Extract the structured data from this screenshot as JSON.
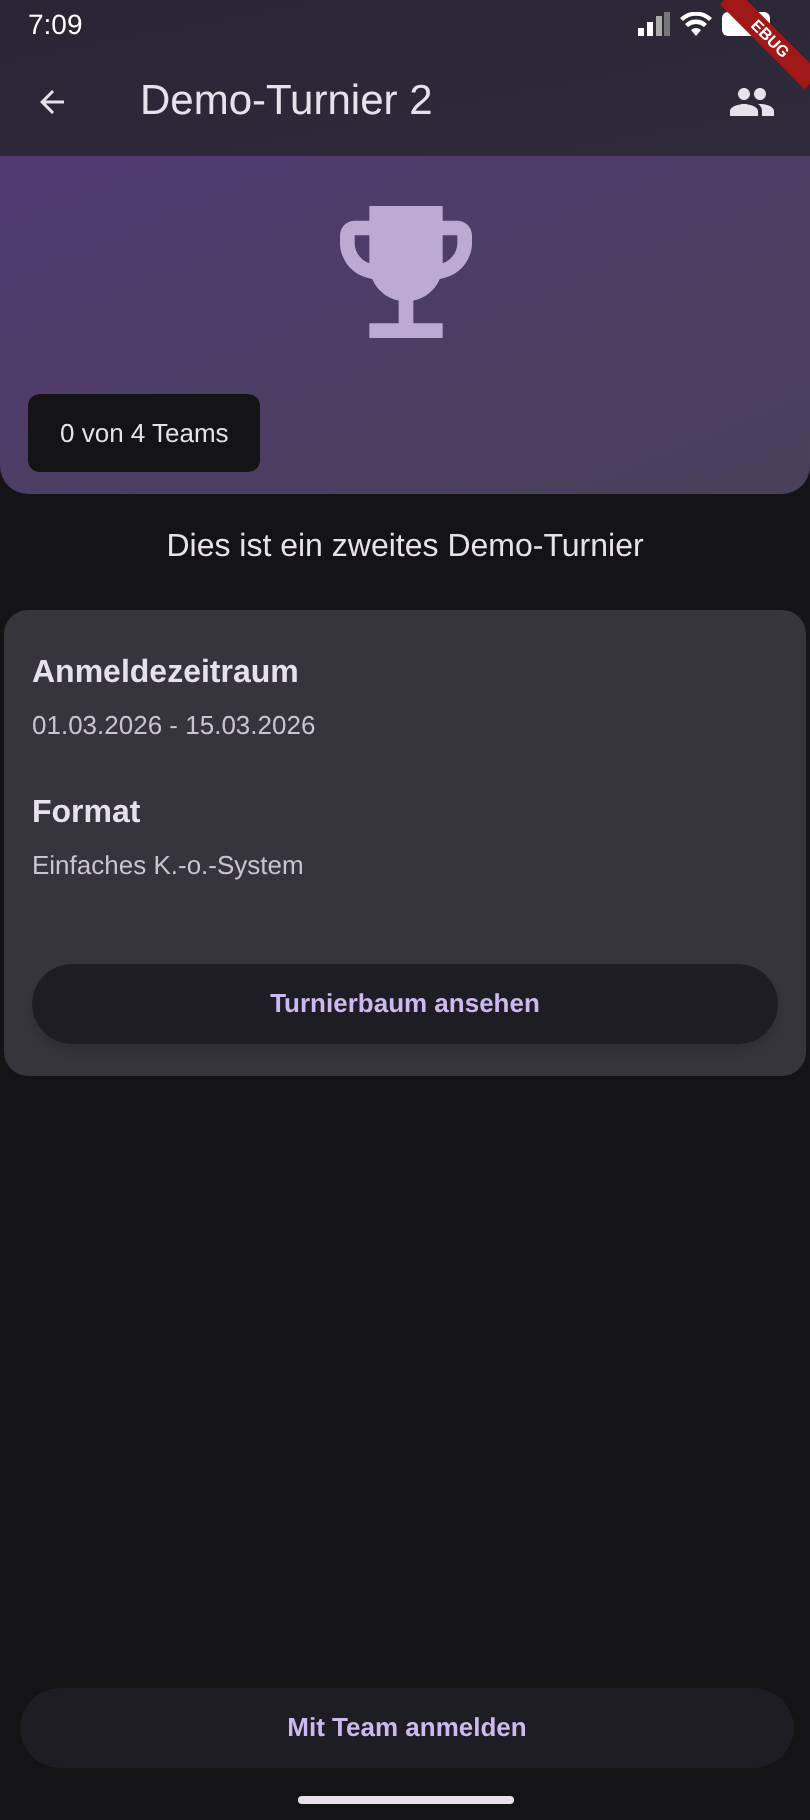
{
  "status_bar": {
    "time": "7:09"
  },
  "debug_banner": {
    "label": "EBUG"
  },
  "app_bar": {
    "title": "Demo-Turnier 2"
  },
  "hero": {
    "team_count": "0 von 4 Teams"
  },
  "description": "Dies ist ein zweites Demo-Turnier",
  "details": [
    {
      "label": "Anmeldezeitraum",
      "value": "01.03.2026 - 15.03.2026"
    },
    {
      "label": "Format",
      "value": "Einfaches K.-o.-System"
    }
  ],
  "bracket_button": "Turnierbaum ansehen",
  "register_button": "Mit Team anmelden"
}
